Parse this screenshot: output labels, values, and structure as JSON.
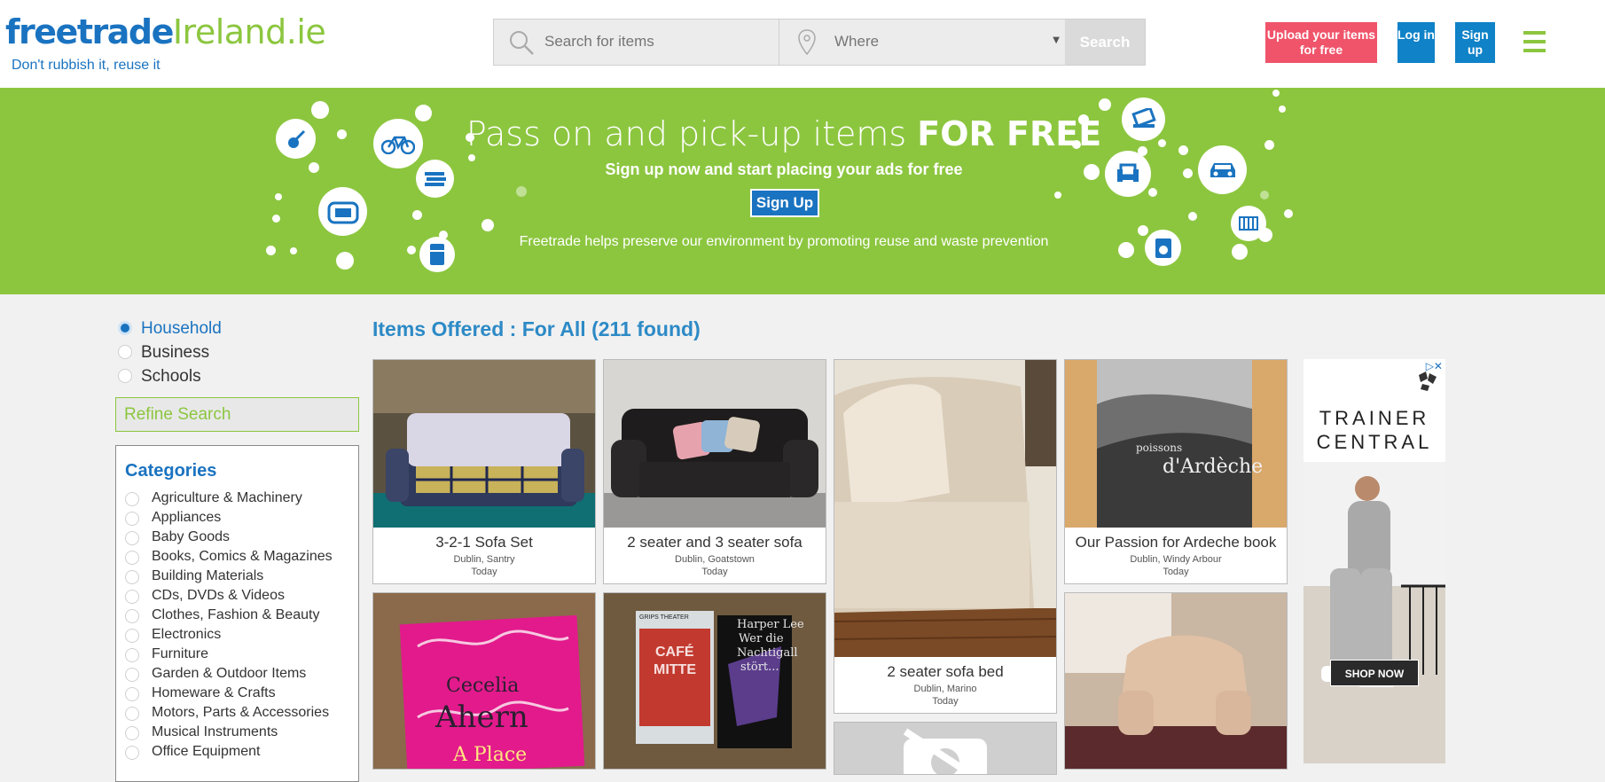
{
  "header": {
    "logo_main": "freetrade",
    "logo_ie": "Ireland.ie",
    "tagline": "Don't rubbish it, reuse it",
    "search_placeholder": "Search for items",
    "where_placeholder": "Where",
    "search_button": "Search",
    "upload_button": "Upload your items for free",
    "login_button": "Log in",
    "signup_button": "Sign up",
    "icons": [
      "search-icon",
      "location-pin-icon",
      "menu-icon"
    ]
  },
  "banner": {
    "headline_light": "Pass on and pick-up items ",
    "headline_bold": "FOR FREE",
    "subtitle": "Sign up now and start placing your ads for free",
    "signup_button": "Sign Up",
    "note": "Freetrade helps preserve our environment by promoting reuse and waste prevention",
    "icons": [
      "violin-icon",
      "bicycle-icon",
      "books-icon",
      "game-console-icon",
      "fridge-icon",
      "laptop-icon",
      "armchair-icon",
      "car-icon",
      "crib-icon",
      "washing-machine-icon"
    ]
  },
  "sidebar": {
    "types": [
      {
        "label": "Household",
        "selected": true
      },
      {
        "label": "Business",
        "selected": false
      },
      {
        "label": "Schools",
        "selected": false
      }
    ],
    "refine_label": "Refine Search",
    "categories_title": "Categories",
    "categories": [
      "Agriculture & Machinery",
      "Appliances",
      "Baby Goods",
      "Books, Comics & Magazines",
      "Building Materials",
      "CDs, DVDs & Videos",
      "Clothes, Fashion & Beauty",
      "Electronics",
      "Furniture",
      "Garden & Outdoor Items",
      "Homeware & Crafts",
      "Motors, Parts & Accessories",
      "Musical Instruments",
      "Office Equipment"
    ]
  },
  "main": {
    "title": "Items Offered : For All (211 found)",
    "items": [
      {
        "title": "3-2-1 Sofa Set",
        "location": "Dublin, Santry",
        "date": "Today"
      },
      {
        "title": "2 seater and 3 seater sofa",
        "location": "Dublin, Goatstown",
        "date": "Today"
      },
      {
        "title": "2 seater sofa bed",
        "location": "Dublin, Marino",
        "date": "Today"
      },
      {
        "title": "Our Passion for Ardeche book",
        "location": "Dublin, Windy Arbour",
        "date": "Today"
      }
    ],
    "photo_text": {
      "book_cover_1": "poissons",
      "book_cover_2": "d'Ardèche",
      "ahern_top": "Cecelia",
      "ahern_bottom": "Ahern",
      "ahern_sub": "A Place",
      "harper": "Harper Lee",
      "harper_title_1": "Wer die",
      "harper_title_2": "Nachtigall",
      "harper_title_3": "stört...",
      "cafe_1": "CAFÉ",
      "cafe_2": "MITTE",
      "grips": "GRIPS THEATER"
    }
  },
  "ad": {
    "brand_line1": "TRAINER",
    "brand_line2": "CENTRAL",
    "cta": "SHOP NOW",
    "adchoices": "▷✕"
  },
  "colors": {
    "brand_blue": "#1a73c0",
    "brand_green": "#8cc63f",
    "upload_red": "#f0546a",
    "button_blue": "#0f82c8"
  }
}
